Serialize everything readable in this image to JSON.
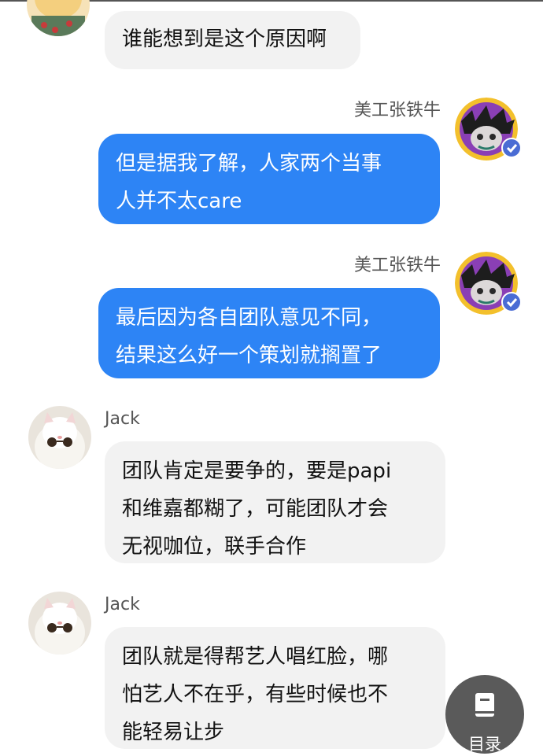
{
  "messages": [
    {
      "sender": "",
      "side": "left",
      "lines": [
        "谁能想到是这个原因啊"
      ]
    },
    {
      "sender": "美工张铁牛",
      "side": "right",
      "lines": [
        "但是据我了解，人家两个当事",
        "人并不太care"
      ]
    },
    {
      "sender": "美工张铁牛",
      "side": "right",
      "lines": [
        "最后因为各自团队意见不同，",
        "结果这么好一个策划就搁置了"
      ]
    },
    {
      "sender": "Jack",
      "side": "left",
      "lines": [
        "团队肯定是要争的，要是papi",
        "和维嘉都糊了，可能团队才会",
        "无视咖位，联手合作"
      ]
    },
    {
      "sender": "Jack",
      "side": "left",
      "lines": [
        "团队就是得帮艺人唱红脸，哪",
        "怕艺人不在乎，有些时候也不",
        "能轻易让步"
      ]
    }
  ],
  "toc_button": {
    "label": "目录",
    "icon": "book-icon"
  },
  "colors": {
    "blue_bubble": "#2d84f5",
    "gray_bubble": "#f2f2f2",
    "verified_badge": "#4a6cd4"
  }
}
